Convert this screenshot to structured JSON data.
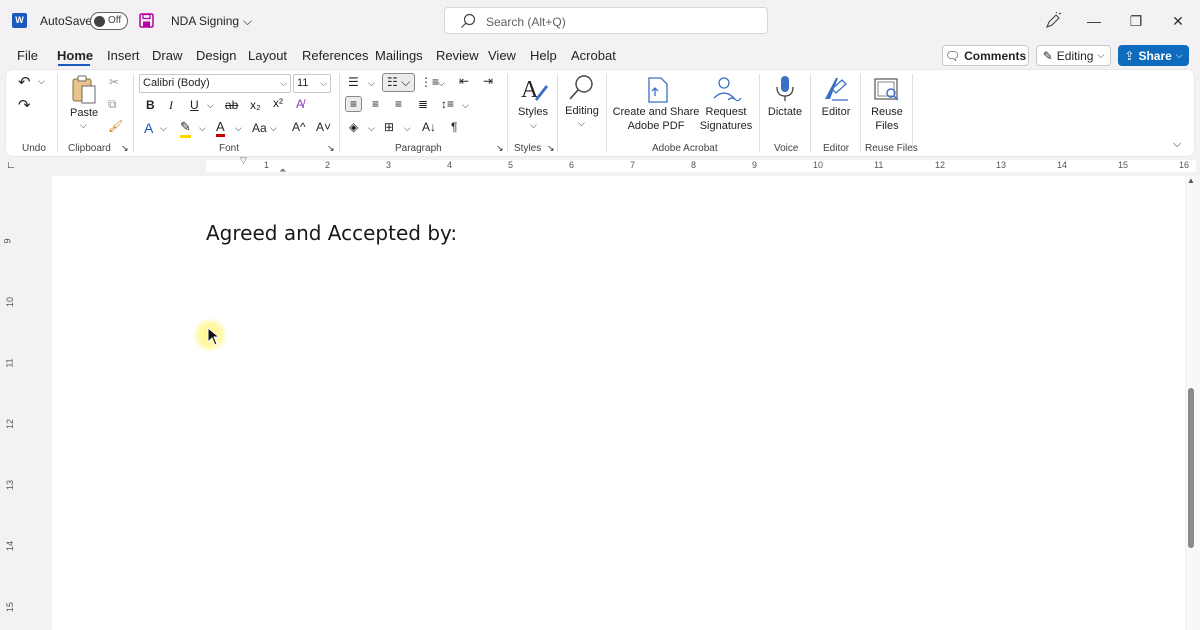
{
  "titlebar": {
    "autosave_label": "AutoSave",
    "autosave_state": "Off",
    "doc_title": "NDA Signing",
    "search_placeholder": "Search (Alt+Q)"
  },
  "menu": {
    "items": [
      "File",
      "Home",
      "Insert",
      "Draw",
      "Design",
      "Layout",
      "References",
      "Mailings",
      "Review",
      "View",
      "Help",
      "Acrobat"
    ],
    "active": "Home",
    "comments_label": "Comments",
    "editing_label": "Editing",
    "share_label": "Share"
  },
  "ribbon": {
    "groups": {
      "undo": "Undo",
      "clipboard": "Clipboard",
      "font": "Font",
      "paragraph": "Paragraph",
      "styles": "Styles",
      "adobe": "Adobe Acrobat",
      "voice": "Voice",
      "editor": "Editor",
      "reuse": "Reuse Files"
    },
    "paste_label": "Paste",
    "font_name": "Calibri (Body)",
    "font_size": "11",
    "styles_label": "Styles",
    "editing_label": "Editing",
    "create_share_label_1": "Create and Share",
    "create_share_label_2": "Adobe PDF",
    "request_sig_label_1": "Request",
    "request_sig_label_2": "Signatures",
    "dictate_label": "Dictate",
    "editor_label": "Editor",
    "reuse_label_1": "Reuse",
    "reuse_label_2": "Files",
    "font_buttons": {
      "bold": "B",
      "italic": "I",
      "underline": "U",
      "strike": "ab",
      "sub": "x₂",
      "sup": "x²",
      "case": "Aa",
      "grow": "A^",
      "shrink": "A˅"
    }
  },
  "ruler": {
    "h_numbers": [
      "1",
      "2",
      "3",
      "4",
      "5",
      "6",
      "7",
      "8",
      "9",
      "10",
      "11",
      "12",
      "13",
      "14",
      "15",
      "16"
    ],
    "v_numbers": [
      "9",
      "10",
      "11",
      "12",
      "13",
      "14",
      "15"
    ]
  },
  "document": {
    "text": "Agreed and Accepted by:"
  },
  "colors": {
    "accent": "#185abd",
    "share": "#0f6cbd",
    "highlight": "#ffd500",
    "font_color": "#c00000"
  }
}
